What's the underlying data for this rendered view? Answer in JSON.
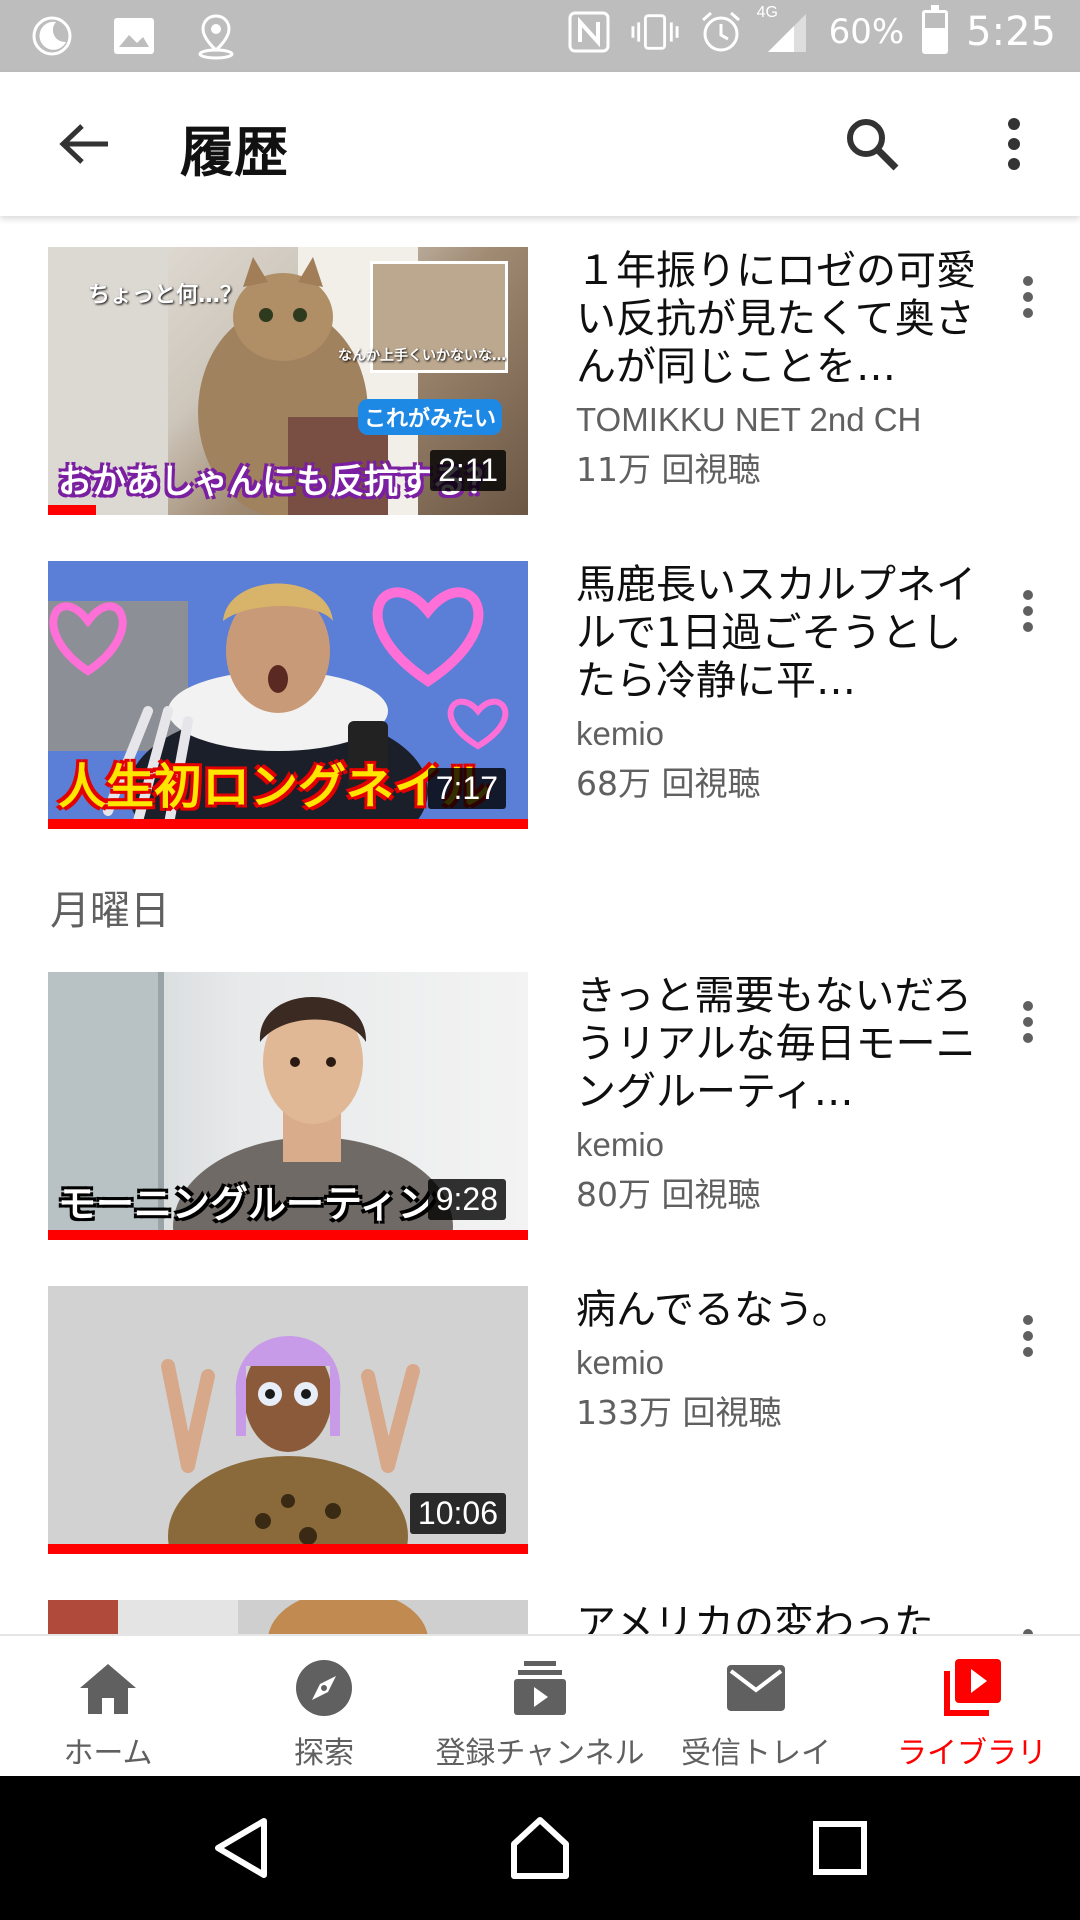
{
  "status_bar": {
    "battery": "60%",
    "network": "4G",
    "time": "5:25"
  },
  "app_bar": {
    "title": "履歴"
  },
  "videos_today": [
    {
      "title": "１年振りにロゼの可愛い反抗が見たくて奥さんが同じことを…",
      "channel": "TOMIKKU NET 2nd CH",
      "views": "11万 回視聴",
      "duration": "2:11",
      "progress": 0.1,
      "thumb_caption": "おかあしゃんにも反抗する？",
      "thumb_subcaption": "ちょっと何…？",
      "thumb_inset_caption": "なんか上手くいかないな…",
      "thumb_inset_label": "これがみたい"
    },
    {
      "title": "馬鹿長いスカルプネイルで1日過ごそうとしたら冷静に平…",
      "channel": "kemio",
      "views": "68万 回視聴",
      "duration": "7:17",
      "progress": 1.0,
      "thumb_caption": "人生初ロングネイル"
    }
  ],
  "section_monday": "月曜日",
  "videos_monday": [
    {
      "title": "きっと需要もないだろうリアルな毎日モーニングルーティ…",
      "channel": "kemio",
      "views": "80万 回視聴",
      "duration": "9:28",
      "progress": 1.0,
      "thumb_caption": "モーニングルーティン"
    },
    {
      "title": "病んでるなう。",
      "channel": "kemio",
      "views": "133万 回視聴",
      "duration": "10:06",
      "progress": 1.0
    },
    {
      "title": "アメリカの変わった"
    }
  ],
  "bottom_nav": {
    "home": "ホーム",
    "explore": "探索",
    "subscriptions": "登録チャンネル",
    "inbox": "受信トレイ",
    "library": "ライブラリ"
  },
  "colors": {
    "accent": "#ff0000",
    "secondary_text": "#606060",
    "status_bar_bg": "#bdbdbd"
  }
}
